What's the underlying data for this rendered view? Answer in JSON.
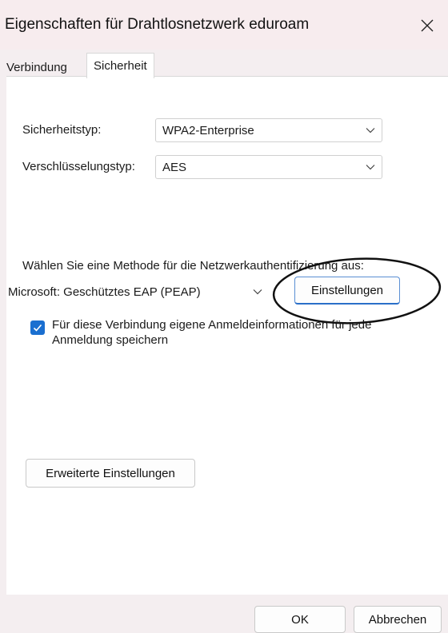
{
  "window": {
    "title": "Eigenschaften für Drahtlosnetzwerk eduroam",
    "close_glyph": "✕"
  },
  "tabs": [
    {
      "label": "Verbindung",
      "active": false
    },
    {
      "label": "Sicherheit",
      "active": true
    }
  ],
  "security": {
    "security_type_label": "Sicherheitstyp:",
    "security_type_value": "WPA2-Enterprise",
    "encryption_type_label": "Verschlüsselungstyp:",
    "encryption_type_value": "AES"
  },
  "auth": {
    "method_prompt": "Wählen Sie eine Methode für die Netzwerkauthentifizierung aus:",
    "method_value": "Microsoft: Geschütztes EAP (PEAP)",
    "settings_button": "Einstellungen",
    "remember_checkbox_label": "Für diese Verbindung eigene Anmeldeinformationen für jede Anmeldung speichern",
    "remember_checked": true
  },
  "advanced_button": "Erweiterte Einstellungen",
  "footer": {
    "ok_label": "OK",
    "cancel_label": "Abbrechen"
  },
  "colors": {
    "accent": "#1a6fd0",
    "titlebar": "#f7ecee"
  },
  "icons": [
    "close-icon",
    "chevron-down-icon",
    "checkmark-icon"
  ]
}
